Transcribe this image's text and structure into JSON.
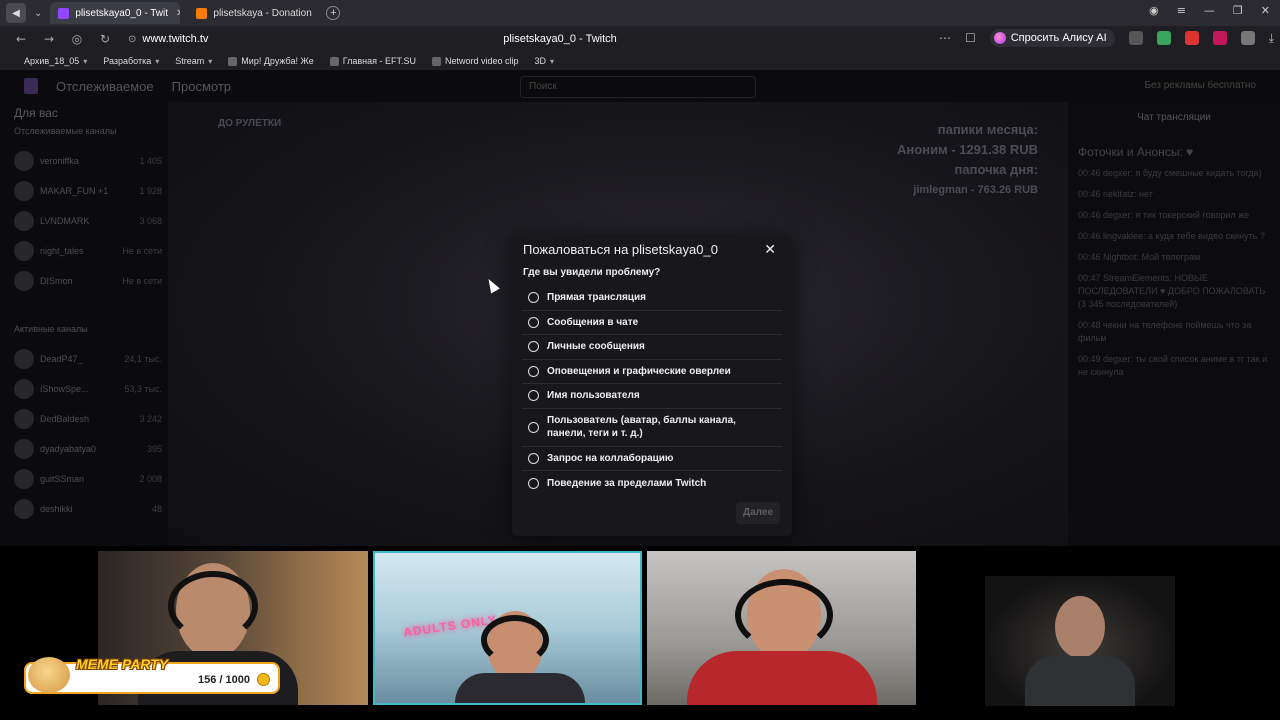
{
  "browser": {
    "tabs": [
      {
        "title": "plisetskaya0_0 - Twit",
        "favicon_color": "#9146ff",
        "active": true
      },
      {
        "title": "plisetskaya - Donation",
        "favicon_color": "#f57d07",
        "active": false
      }
    ],
    "url": "www.twitch.tv",
    "page_title": "plisetskaya0_0 - Twitch",
    "alice_button": "Спросить Алису AI",
    "bookmarks": [
      "Архив_18_05",
      "Разработка",
      "Stream",
      "Мир! Дружба! Же",
      "Главная - EFT.SU",
      "Netword video clip",
      "3D"
    ]
  },
  "twitch": {
    "nav": [
      "Отслеживаемое",
      "Просмотр"
    ],
    "search_placeholder": "Поиск",
    "no_ads": "Без рекламы бесплатно",
    "sidebar": {
      "header": "Для вас",
      "followed_label": "Отслеживаемые каналы",
      "followed": [
        {
          "name": "veroniffka",
          "count": "1 405"
        },
        {
          "name": "MAKAR_FUN +1",
          "count": "1 928"
        },
        {
          "name": "LVNDMARK",
          "count": "3 068"
        },
        {
          "name": "night_tales",
          "count": "Не в сети"
        },
        {
          "name": "DISmon",
          "count": "Не в сети"
        }
      ],
      "active_label": "Активные каналы",
      "active": [
        {
          "name": "DeadP47_",
          "count": "24,1 тыс."
        },
        {
          "name": "IShowSpe...",
          "count": "53,3 тыс."
        },
        {
          "name": "DedBaldesh",
          "count": "3 242"
        },
        {
          "name": "dyadyabatya0",
          "count": "395"
        },
        {
          "name": "guitSSman",
          "count": "2 008"
        },
        {
          "name": "deshikki",
          "count": "48"
        }
      ]
    },
    "video": {
      "top_left": "ДО РУЛЕТКИ",
      "top_right_lines": [
        "папики месяца:",
        "Аноним - 1291.38 RUB",
        "папочка дня:",
        "jimlegman - 763.26 RUB"
      ]
    },
    "chat": {
      "title": "Чат трансляции",
      "pinned": "Фоточки и Анонсы: ♥",
      "lines": [
        "00:46 degxer: я буду смешные кидать тогда)",
        "00:46 nekitatz: нет",
        "00:46 degxer: я тик токерский говорил же",
        "00:46 lingvaklee: а куда тебе видео скинуть ?",
        "00:46 Nightbot: Мой телеграм",
        "00:47 StreamElements: НОВЫЕ ПОСЛЕДОВАТЕЛИ ♥ ДОБРО ПОЖАЛОВАТЬ (3 345 последователей)",
        "00:48 чекни на телефоне поймешь что за фильм",
        "00:49 degxer: ты свой список аниме в тг так и не скинула"
      ]
    }
  },
  "modal": {
    "title": "Пожаловаться на plisetskaya0_0",
    "question": "Где вы увидели проблему?",
    "options": [
      "Прямая трансляция",
      "Сообщения в чате",
      "Личные сообщения",
      "Оповещения и графические оверлеи",
      "Имя пользователя",
      "Пользователь (аватар, баллы канала, панели, теги и т. д.)",
      "Запрос на коллаборацию",
      "Поведение за пределами Twitch"
    ],
    "next_button": "Далее"
  },
  "overlay": {
    "meme_title": "MEME PARTY",
    "meme_count": "156 / 1000",
    "neon_sign": "ADULTS ONLY"
  },
  "colors": {
    "modal_bg": "#18181b",
    "page_bg": "#0e0e10",
    "twitch_purple": "#9146ff",
    "meme_gold": "#ffd21f"
  }
}
